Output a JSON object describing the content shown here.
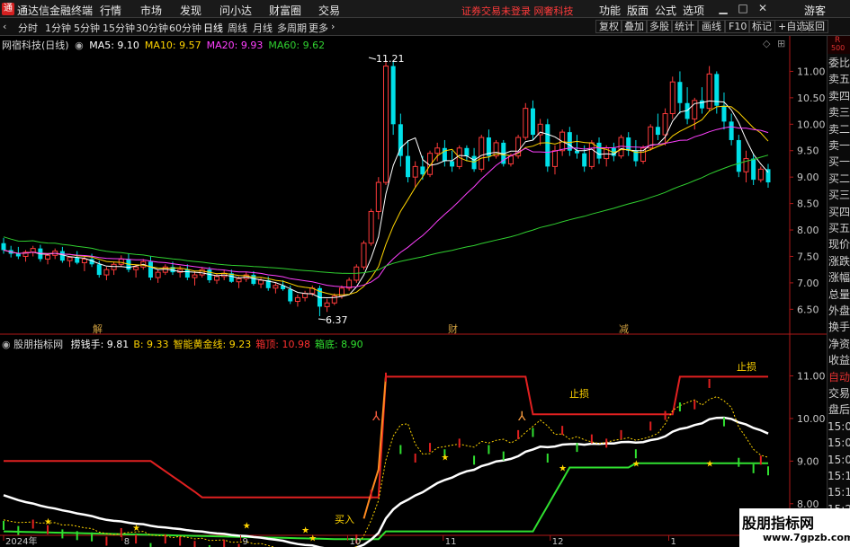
{
  "app": {
    "title": "通达信金融终端",
    "menu": [
      "行情",
      "市场",
      "发现",
      "问小达",
      "财富圈",
      "交易"
    ],
    "notice": "证券交易未登录  网奢科技",
    "right_menu": [
      "功能",
      "版面",
      "公式",
      "选项"
    ],
    "guest": "游客",
    "window_controls": [
      "minimize-icon",
      "maximize-icon",
      "close-icon"
    ]
  },
  "toolbar": {
    "periods": [
      "分时",
      "1分钟",
      "5分钟",
      "15分钟",
      "30分钟",
      "60分钟",
      "日线",
      "周线",
      "月线",
      "多周期",
      "更多"
    ],
    "active_period": "日线",
    "tools": [
      "复权",
      "叠加",
      "多股",
      "统计",
      "画线",
      "F10",
      "标记",
      "+自选",
      "返回"
    ]
  },
  "main_chart": {
    "stock_title": "网宿科技(日线)",
    "ma_labels": [
      {
        "text": "MA5: 9.10",
        "color": "#ffffff"
      },
      {
        "text": "MA10: 9.57",
        "color": "#ffd400"
      },
      {
        "text": "MA20: 9.93",
        "color": "#ff40ff"
      },
      {
        "text": "MA60: 9.62",
        "color": "#30d030"
      }
    ],
    "price_axis": [
      "11.00",
      "10.50",
      "10.00",
      "9.50",
      "9.00",
      "8.50",
      "8.00",
      "7.50",
      "7.00",
      "6.50"
    ],
    "high_label": "11.21",
    "low_label": "6.37",
    "markers": [
      "解",
      "财",
      "减"
    ]
  },
  "indicator": {
    "title": "股朋指标网",
    "values": [
      {
        "text": "捞钱手: 9.81",
        "color": "#ffffff"
      },
      {
        "text": "B: 9.33",
        "color": "#ffd400"
      },
      {
        "text": "智能黄金线: 9.23",
        "color": "#ffd400"
      },
      {
        "text": "箱顶: 10.98",
        "color": "#ff3030"
      },
      {
        "text": "箱底: 8.90",
        "color": "#30e030"
      }
    ],
    "price_axis": [
      "11.00",
      "10.00",
      "9.00",
      "8.00"
    ],
    "labels": {
      "stop1": "止损",
      "stop2": "止损",
      "buy": "买入"
    }
  },
  "time_axis": [
    "2024年",
    "8",
    "9",
    "10",
    "11",
    "12",
    "1"
  ],
  "sidebar": {
    "badge": "R 500",
    "items": [
      "委比",
      "卖五",
      "卖四",
      "卖三",
      "卖二",
      "卖一",
      "买一",
      "买二",
      "买三",
      "买四",
      "买五",
      "现价",
      "涨跌",
      "涨幅",
      "总量",
      "外盘",
      "换手",
      "净资",
      "收益",
      "自动",
      "交易",
      "盘后",
      "15:0",
      "15:0",
      "15:0",
      "15:1",
      "15:1",
      "15:2",
      "15:2",
      "15:3"
    ]
  },
  "watermark": {
    "line1": "股朋指标网",
    "line2": "www.7gpzb.com"
  },
  "chart_data": {
    "type": "candlestick",
    "title": "网宿科技(日线)",
    "ylim": [
      6.2,
      11.5
    ],
    "x": [
      "2024-07",
      "2024-08",
      "2024-09",
      "2024-10",
      "2024-11",
      "2024-12",
      "2025-01"
    ],
    "ohlc": [
      [
        7.75,
        7.85,
        7.55,
        7.62
      ],
      [
        7.62,
        7.7,
        7.48,
        7.55
      ],
      [
        7.55,
        7.68,
        7.45,
        7.5
      ],
      [
        7.5,
        7.62,
        7.4,
        7.58
      ],
      [
        7.58,
        7.7,
        7.5,
        7.65
      ],
      [
        7.65,
        7.72,
        7.4,
        7.45
      ],
      [
        7.45,
        7.55,
        7.35,
        7.52
      ],
      [
        7.52,
        7.65,
        7.45,
        7.6
      ],
      [
        7.6,
        7.68,
        7.38,
        7.42
      ],
      [
        7.42,
        7.5,
        7.3,
        7.48
      ],
      [
        7.48,
        7.6,
        7.35,
        7.38
      ],
      [
        7.38,
        7.5,
        7.22,
        7.45
      ],
      [
        7.45,
        7.55,
        7.3,
        7.35
      ],
      [
        7.35,
        7.42,
        7.1,
        7.15
      ],
      [
        7.15,
        7.3,
        7.05,
        7.25
      ],
      [
        7.25,
        7.4,
        7.15,
        7.35
      ],
      [
        7.35,
        7.52,
        7.3,
        7.45
      ],
      [
        7.45,
        7.55,
        7.2,
        7.25
      ],
      [
        7.25,
        7.35,
        7.1,
        7.3
      ],
      [
        7.3,
        7.45,
        7.25,
        7.4
      ],
      [
        7.4,
        7.5,
        7.05,
        7.1
      ],
      [
        7.1,
        7.25,
        7.0,
        7.2
      ],
      [
        7.2,
        7.35,
        7.15,
        7.3
      ],
      [
        7.3,
        7.4,
        7.15,
        7.2
      ],
      [
        7.2,
        7.32,
        7.1,
        7.25
      ],
      [
        7.25,
        7.35,
        7.05,
        7.1
      ],
      [
        7.1,
        7.22,
        6.95,
        7.15
      ],
      [
        7.15,
        7.3,
        7.1,
        7.25
      ],
      [
        7.25,
        7.3,
        7.0,
        7.05
      ],
      [
        7.05,
        7.18,
        6.98,
        7.12
      ],
      [
        7.12,
        7.25,
        7.05,
        7.18
      ],
      [
        7.18,
        7.25,
        7.0,
        7.02
      ],
      [
        7.02,
        7.12,
        6.9,
        7.08
      ],
      [
        7.08,
        7.2,
        7.02,
        7.15
      ],
      [
        7.15,
        7.22,
        6.95,
        6.98
      ],
      [
        6.98,
        7.1,
        6.9,
        7.05
      ],
      [
        7.05,
        7.12,
        6.85,
        6.9
      ],
      [
        6.9,
        7.0,
        6.8,
        6.95
      ],
      [
        6.95,
        7.05,
        6.85,
        6.88
      ],
      [
        6.88,
        6.95,
        6.6,
        6.65
      ],
      [
        6.65,
        6.78,
        6.55,
        6.72
      ],
      [
        6.72,
        6.85,
        6.65,
        6.8
      ],
      [
        6.8,
        6.95,
        6.75,
        6.9
      ],
      [
        6.9,
        6.95,
        6.37,
        6.55
      ],
      [
        6.55,
        6.7,
        6.45,
        6.62
      ],
      [
        6.62,
        6.8,
        6.58,
        6.75
      ],
      [
        6.75,
        6.95,
        6.7,
        6.9
      ],
      [
        6.9,
        7.1,
        6.85,
        7.05
      ],
      [
        7.05,
        7.35,
        7.0,
        7.3
      ],
      [
        7.3,
        7.8,
        7.25,
        7.75
      ],
      [
        7.75,
        8.4,
        7.7,
        8.35
      ],
      [
        8.35,
        9.0,
        8.2,
        8.9
      ],
      [
        8.9,
        11.21,
        8.85,
        11.1
      ],
      [
        11.1,
        11.2,
        9.8,
        10.0
      ],
      [
        10.0,
        10.2,
        9.2,
        9.4
      ],
      [
        9.4,
        9.7,
        8.9,
        9.0
      ],
      [
        9.0,
        9.3,
        8.8,
        9.2
      ],
      [
        9.2,
        9.4,
        8.95,
        9.05
      ],
      [
        9.05,
        9.5,
        9.0,
        9.45
      ],
      [
        9.45,
        9.65,
        9.3,
        9.55
      ],
      [
        9.55,
        9.7,
        9.2,
        9.3
      ],
      [
        9.3,
        9.5,
        9.1,
        9.2
      ],
      [
        9.2,
        9.6,
        9.15,
        9.55
      ],
      [
        9.55,
        9.6,
        9.3,
        9.4
      ],
      [
        9.4,
        9.55,
        9.1,
        9.15
      ],
      [
        9.15,
        9.8,
        9.1,
        9.75
      ],
      [
        9.75,
        9.9,
        9.3,
        9.4
      ],
      [
        9.4,
        9.7,
        9.35,
        9.65
      ],
      [
        9.65,
        9.7,
        9.2,
        9.25
      ],
      [
        9.25,
        9.45,
        9.2,
        9.4
      ],
      [
        9.4,
        9.8,
        9.35,
        9.75
      ],
      [
        9.75,
        10.4,
        9.7,
        10.3
      ],
      [
        10.3,
        10.45,
        9.7,
        9.8
      ],
      [
        9.8,
        10.1,
        9.6,
        10.0
      ],
      [
        10.0,
        10.1,
        9.1,
        9.2
      ],
      [
        9.2,
        9.6,
        9.05,
        9.5
      ],
      [
        9.5,
        9.9,
        9.4,
        9.85
      ],
      [
        9.85,
        9.95,
        9.4,
        9.5
      ],
      [
        9.5,
        9.8,
        9.35,
        9.45
      ],
      [
        9.45,
        9.6,
        9.1,
        9.2
      ],
      [
        9.2,
        9.7,
        9.15,
        9.65
      ],
      [
        9.65,
        9.75,
        9.25,
        9.35
      ],
      [
        9.35,
        9.6,
        9.2,
        9.55
      ],
      [
        9.55,
        9.65,
        9.3,
        9.4
      ],
      [
        9.4,
        9.8,
        9.35,
        9.75
      ],
      [
        9.75,
        9.85,
        9.4,
        9.5
      ],
      [
        9.5,
        9.7,
        9.2,
        9.3
      ],
      [
        9.3,
        9.6,
        9.25,
        9.55
      ],
      [
        9.55,
        10.0,
        9.5,
        9.95
      ],
      [
        9.95,
        10.2,
        9.7,
        9.8
      ],
      [
        9.8,
        10.3,
        9.6,
        10.2
      ],
      [
        10.2,
        10.9,
        10.1,
        10.8
      ],
      [
        10.8,
        11.0,
        10.2,
        10.4
      ],
      [
        10.4,
        10.7,
        10.0,
        10.1
      ],
      [
        10.1,
        10.5,
        9.9,
        10.45
      ],
      [
        10.45,
        10.7,
        10.2,
        10.3
      ],
      [
        10.3,
        11.1,
        10.25,
        10.95
      ],
      [
        10.95,
        11.0,
        10.2,
        10.35
      ],
      [
        10.35,
        10.6,
        9.9,
        10.05
      ],
      [
        10.05,
        10.2,
        9.6,
        9.7
      ],
      [
        9.7,
        9.8,
        9.0,
        9.1
      ],
      [
        9.1,
        9.5,
        8.9,
        9.35
      ],
      [
        9.35,
        9.45,
        8.85,
        8.95
      ],
      [
        8.95,
        9.2,
        8.9,
        9.15
      ],
      [
        9.15,
        9.25,
        8.8,
        8.9
      ]
    ],
    "series": [
      {
        "name": "MA5",
        "last": 9.1,
        "color": "#ffffff"
      },
      {
        "name": "MA10",
        "last": 9.57,
        "color": "#ffd400"
      },
      {
        "name": "MA20",
        "last": 9.93,
        "color": "#ff40ff"
      },
      {
        "name": "MA60",
        "last": 9.62,
        "color": "#30d030"
      }
    ],
    "high": 11.21,
    "low": 6.37,
    "indicator_ylim": [
      7.3,
      11.6
    ],
    "indicator_series": [
      {
        "name": "捞钱手",
        "last": 9.81,
        "color": "#ffffff"
      },
      {
        "name": "B",
        "last": 9.33,
        "color": "#ffd400"
      },
      {
        "name": "智能黄金线",
        "last": 9.23,
        "color": "#ffd400"
      },
      {
        "name": "箱顶",
        "last": 10.98,
        "color": "#ff3030"
      },
      {
        "name": "箱底",
        "last": 8.9,
        "color": "#30e030"
      }
    ],
    "grid": false
  }
}
